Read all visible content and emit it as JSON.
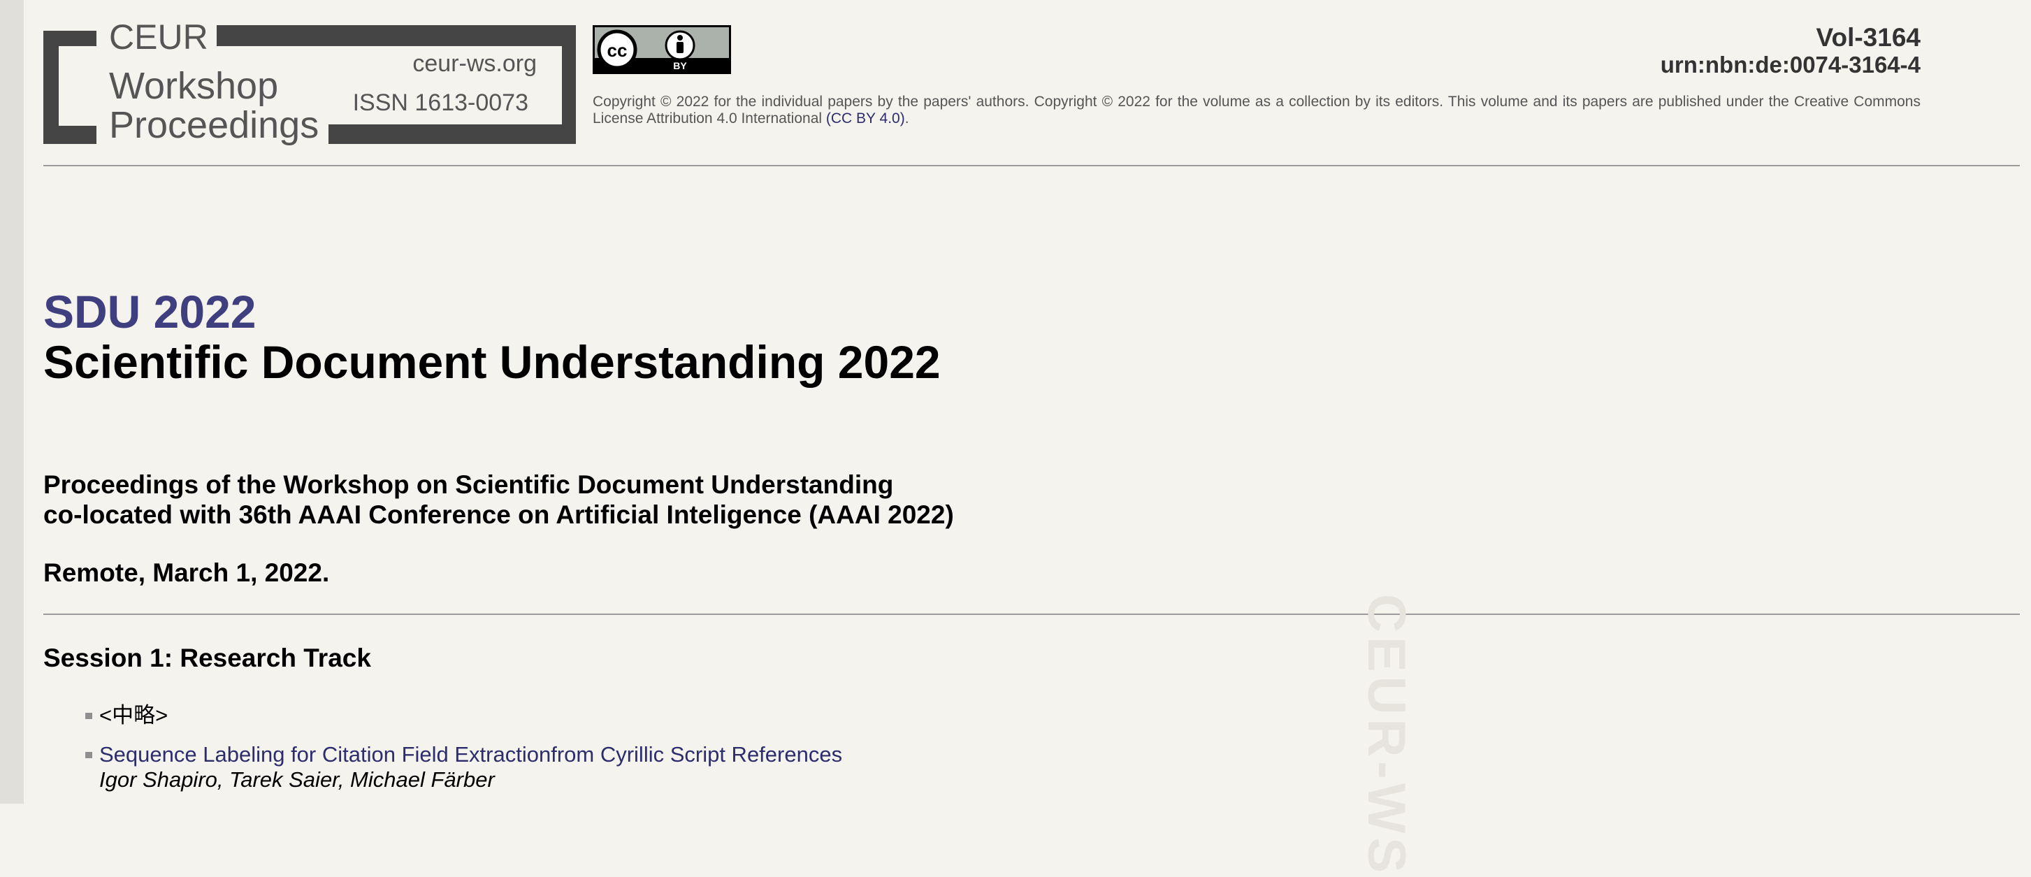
{
  "logo": {
    "line1": "CEUR",
    "line2": "Workshop",
    "line3": "Proceedings",
    "site": "ceur-ws.org",
    "issn": "ISSN 1613-0073"
  },
  "cc_badge": {
    "by_label": "BY"
  },
  "volume": {
    "id": "Vol-3164",
    "urn": "urn:nbn:de:0074-3164-4"
  },
  "copyright": {
    "text": "Copyright © 2022 for the individual papers by the papers' authors. Copyright © 2022 for the volume as a collection by its editors. This volume and its papers are published under the Creative Commons License Attribution 4.0 International ",
    "link_text": "(CC BY 4.0)",
    "end": "."
  },
  "workshop": {
    "acronym": "SDU 2022",
    "title": "Scientific Document Understanding 2022",
    "proceedings_line1": "Proceedings of the Workshop on Scientific Document Understanding",
    "proceedings_line2": "co-located with 36th AAAI Conference on Artificial Inteligence (AAAI 2022)",
    "place_date": "Remote, March 1, 2022."
  },
  "session": {
    "title": "Session 1: Research Track",
    "items": [
      {
        "text": "<中略>"
      },
      {
        "title": "Sequence Labeling for Citation Field Extractionfrom Cyrillic Script References",
        "authors": [
          "Igor Shapiro",
          "Tarek Saier",
          "Michael Färber"
        ]
      }
    ]
  },
  "watermark": "CEUR-WS",
  "colors": {
    "background": "#f4f3ee",
    "accent": "#3f3f7f",
    "link": "#2d2d6e",
    "rule": "#9a9a9a"
  }
}
